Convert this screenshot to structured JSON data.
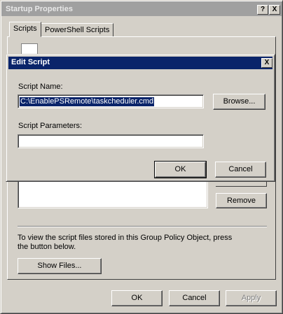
{
  "window": {
    "title": "Startup Properties",
    "help_btn": "?",
    "close_btn": "X"
  },
  "tabs": [
    {
      "label": "Scripts"
    },
    {
      "label": "PowerShell Scripts"
    }
  ],
  "scripts_tab": {
    "remove_label": "Remove",
    "info_text": "To view the script files stored in this Group Policy Object, press the button below.",
    "show_files_label": "Show Files..."
  },
  "footer": {
    "ok_label": "OK",
    "cancel_label": "Cancel",
    "apply_label": "Apply"
  },
  "edit_dialog": {
    "title": "Edit Script",
    "close_btn": "X",
    "script_name_label": "Script Name:",
    "script_name_value": "C:\\EnablePSRemote\\taskcheduler.cmd",
    "browse_label": "Browse...",
    "script_params_label": "Script Parameters:",
    "script_params_value": "",
    "ok_label": "OK",
    "cancel_label": "Cancel"
  }
}
